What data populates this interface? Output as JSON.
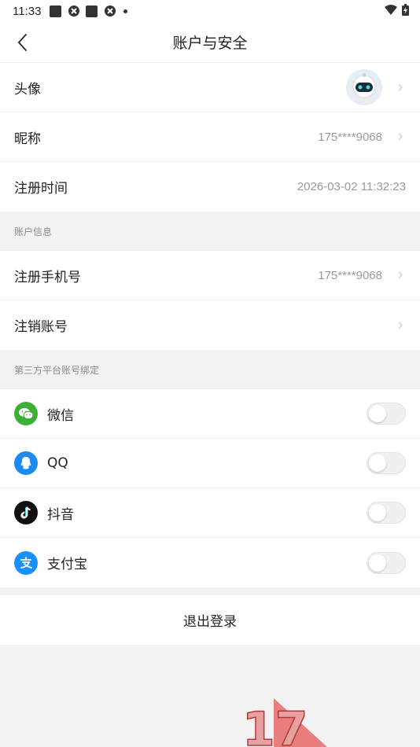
{
  "status_bar": {
    "time": "11:33"
  },
  "header": {
    "title": "账户与安全"
  },
  "profile": {
    "avatar_label": "头像",
    "nickname_label": "昵称",
    "nickname_value": "175****9068",
    "register_time_label": "注册时间",
    "register_time_value": "2026-03-02 11:32:23"
  },
  "account_info": {
    "section_title": "账户信息",
    "phone_label": "注册手机号",
    "phone_value": "175****9068",
    "cancel_label": "注销账号"
  },
  "third_party": {
    "section_title": "第三方平台账号绑定",
    "items": [
      {
        "label": "微信",
        "icon": "wechat-icon",
        "color": "#3cb034",
        "bound": false
      },
      {
        "label": "QQ",
        "icon": "qq-icon",
        "color": "#1e8af0",
        "bound": false
      },
      {
        "label": "抖音",
        "icon": "douyin-icon",
        "color": "#111111",
        "bound": false
      },
      {
        "label": "支付宝",
        "icon": "alipay-icon",
        "color": "#1890ff",
        "bound": false
      }
    ]
  },
  "logout": {
    "label": "退出登录"
  },
  "watermark": {
    "text": "17"
  }
}
